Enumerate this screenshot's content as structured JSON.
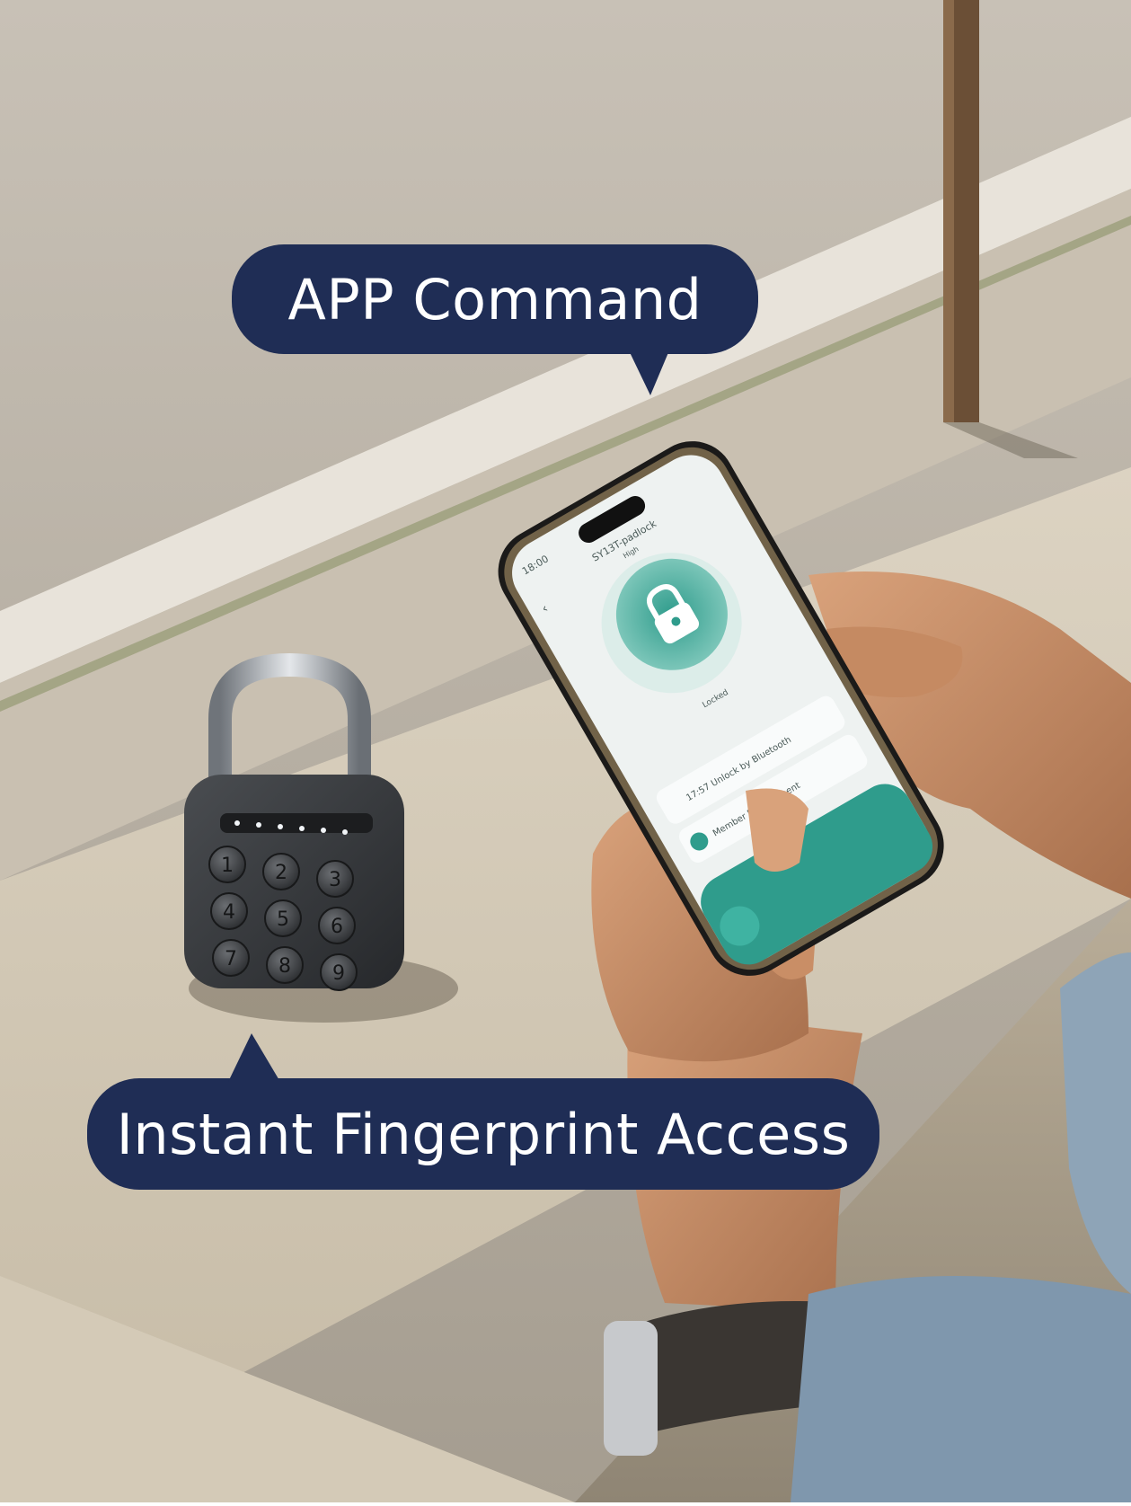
{
  "callouts": {
    "app_command": "APP Command",
    "fingerprint_access": "Instant Fingerprint Access"
  },
  "phone_screen": {
    "time": "18:00",
    "device_name": "SY13T-padlock",
    "signal": "High",
    "lock_status": "Locked",
    "log_entry": "17:57  Unlock by Bluetooth",
    "member_management": "Member Management"
  },
  "padlock": {
    "keys": [
      "1",
      "2",
      "3",
      "4",
      "5",
      "6",
      "7",
      "8",
      "9"
    ]
  },
  "colors": {
    "callout_bg": "#1f2d55",
    "callout_text": "#ffffff",
    "app_accent": "#2f9c8c"
  }
}
